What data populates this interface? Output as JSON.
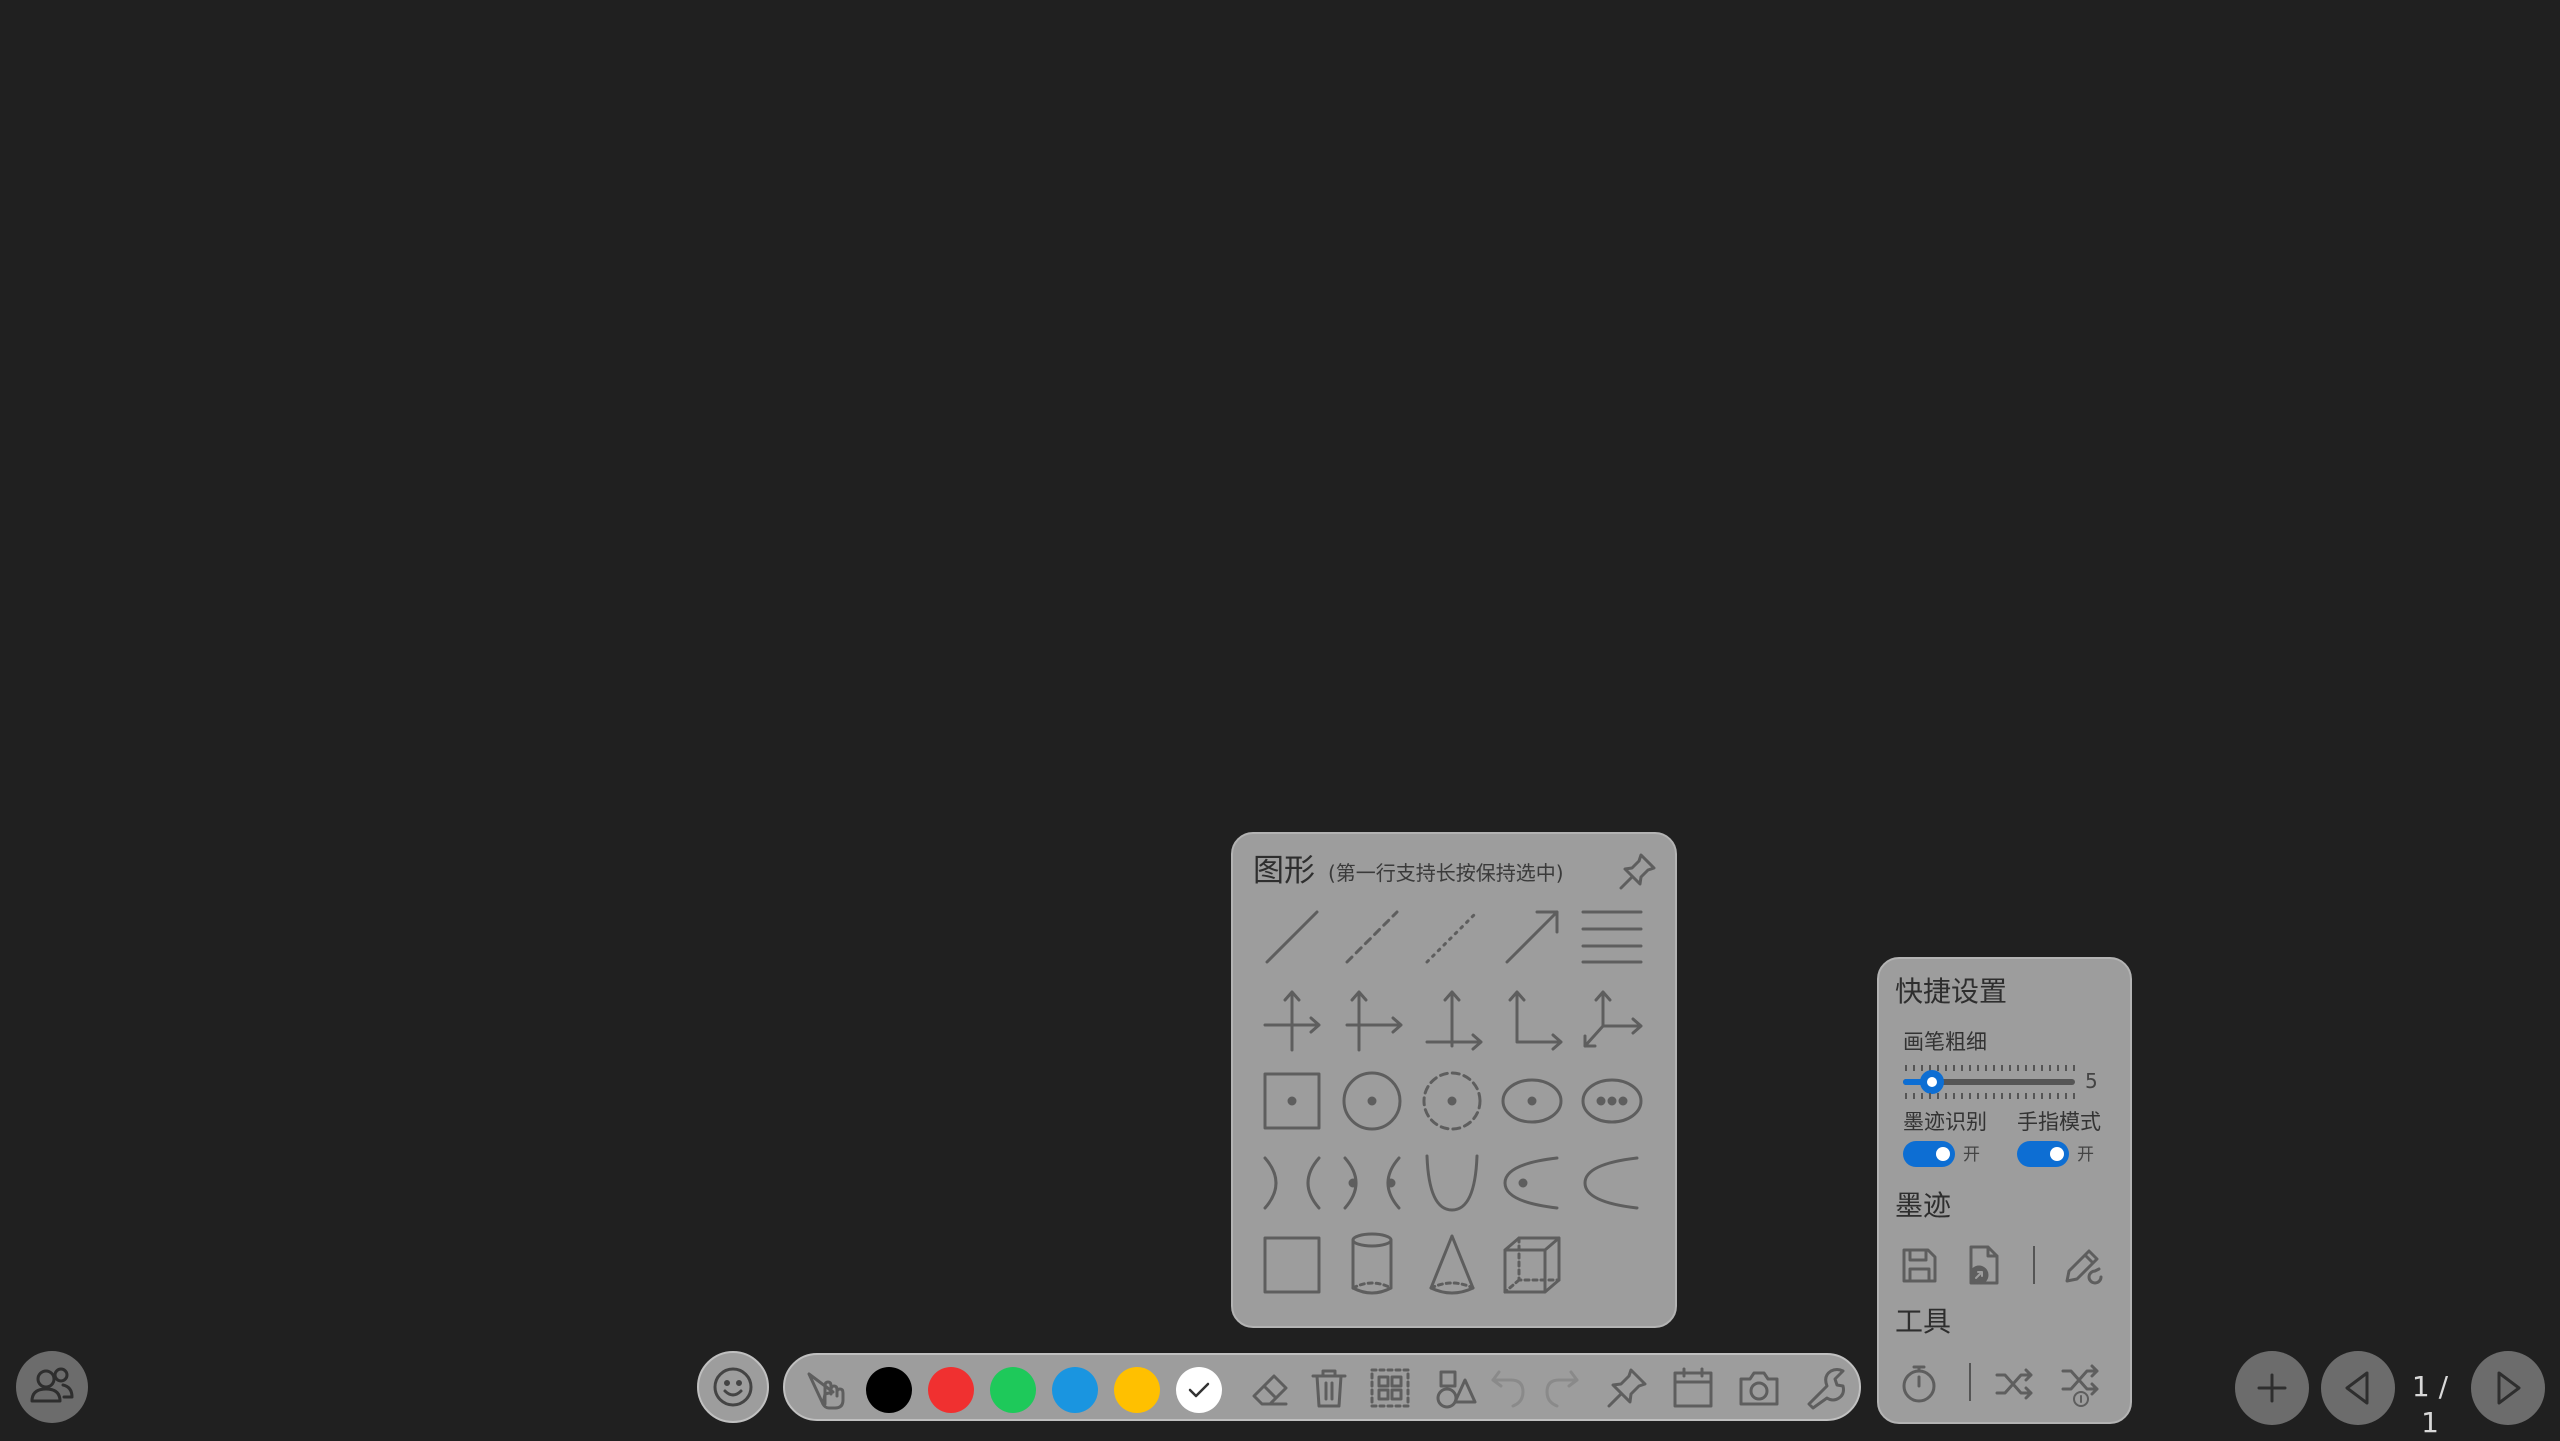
{
  "colors": {
    "background": "#202020",
    "panel": "#9d9d9d",
    "accent": "#0d6ed3",
    "swatches": [
      "#000000",
      "#f03030",
      "#1ec95a",
      "#1a95e0",
      "#ffc000",
      "#ffffff"
    ]
  },
  "shapes_panel": {
    "title": "图形",
    "hint": "(第一行支持长按保持选中)",
    "pin_icon": "pin-icon",
    "rows": [
      [
        "line-icon",
        "dashed-line-icon",
        "dotted-line-icon",
        "arrow-line-icon",
        "parallel-lines-icon"
      ],
      [
        "axis-2d-icon",
        "axis-2d-offset-icon",
        "axis-y-up-icon",
        "axis-first-quadrant-icon",
        "axis-3d-icon"
      ],
      [
        "square-center-icon",
        "circle-center-icon",
        "dashed-circle-center-icon",
        "ellipse-center-icon",
        "ellipse-foci-icon"
      ],
      [
        "hyperbola-icon",
        "hyperbola-foci-icon",
        "parabola-up-icon",
        "parabola-left-focus-icon",
        "parabola-left-icon"
      ],
      [
        "rectangle-icon",
        "cylinder-icon",
        "cone-icon",
        "cube-icon"
      ]
    ]
  },
  "quick_settings": {
    "title": "快捷设置",
    "thickness_label": "画笔粗细",
    "thickness_value": "5",
    "thickness_fraction": 0.17,
    "ink_recognition_label": "墨迹识别",
    "ink_recognition_state": "开",
    "finger_mode_label": "手指模式",
    "finger_mode_state": "开",
    "ink_section": "墨迹",
    "tools_section": "工具"
  },
  "toolbar": {
    "selected_color_index": 5
  },
  "pagination": {
    "label": "1 / 1"
  }
}
